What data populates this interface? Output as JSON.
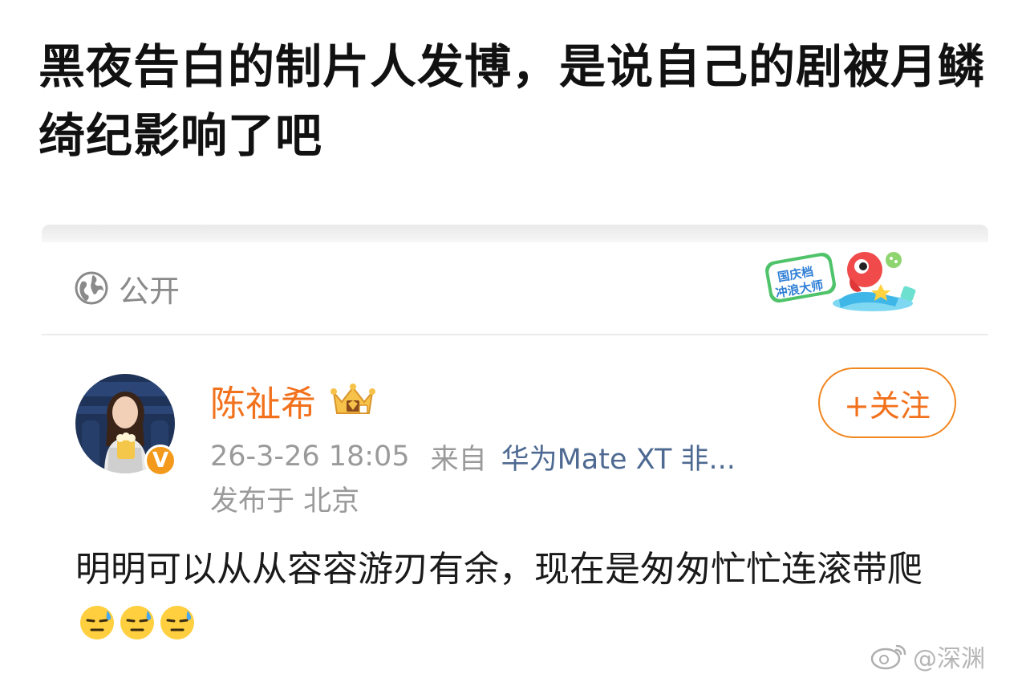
{
  "headline": "黑夜告白的制片人发博，是说自己的剧被月鳞绮纪影响了吧",
  "card": {
    "visibility": {
      "label": "公开",
      "icon": "globe-icon"
    },
    "sticker": {
      "text_line1": "国庆档",
      "text_line2": "冲浪大师"
    },
    "author": {
      "name": "陈祉希",
      "verified_badge": "V",
      "crown_icon": "vip-crown-icon"
    },
    "meta": {
      "time": "26-3-26 18:05",
      "from_label": "来自",
      "device": "华为Mate XT 非...",
      "location": "发布于 北京"
    },
    "follow_button": "+关注",
    "post_text": "明明可以从从容容游刃有余，现在是匆匆忙忙连滚带爬"
  },
  "watermark": {
    "text": "@深渊"
  },
  "colors": {
    "accent_orange": "#f2711c",
    "device_link": "#4e6a92",
    "meta_gray": "#9a9a9a"
  }
}
